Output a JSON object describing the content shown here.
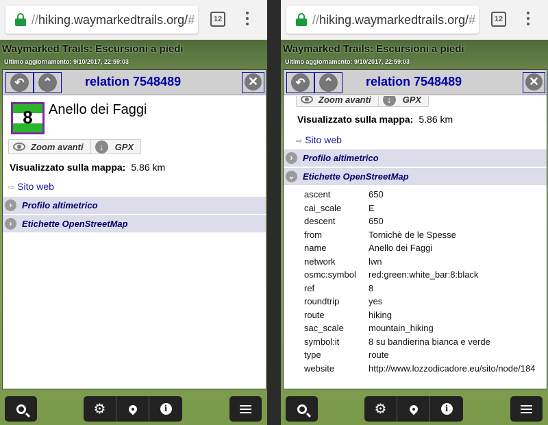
{
  "browser": {
    "url_prefix": "//",
    "url_host": "hiking.waymarkedtrails.org/",
    "url_rest": "#",
    "tab_count": "12"
  },
  "site": {
    "title": "Waymarked Trails: Escursioni a piedi",
    "last_update": "Ultimo aggiornamento: 9/10/2017, 22:59:03"
  },
  "panel": {
    "title": "relation 7548489",
    "back_icon": "undo-icon",
    "up_icon": "chevron-up-icon",
    "close_icon": "close-icon"
  },
  "route": {
    "symbol_number": "8",
    "name": "Anello dei Faggi",
    "zoom_label": "Zoom avanti",
    "gpx_label": "GPX",
    "distance_label": "Visualizzato sulla mappa:",
    "distance_value": "5.86 km",
    "website_label": "Sito web"
  },
  "sections": {
    "elevation": "Profilo altimetrico",
    "osm_tags": "Etichette OpenStreetMap"
  },
  "tags": [
    {
      "key": "ascent",
      "value": "650"
    },
    {
      "key": "cai_scale",
      "value": "E"
    },
    {
      "key": "descent",
      "value": "650"
    },
    {
      "key": "from",
      "value": "Tornichè de le Spesse"
    },
    {
      "key": "name",
      "value": "Anello dei Faggi"
    },
    {
      "key": "network",
      "value": "lwn"
    },
    {
      "key": "osmc:symbol",
      "value": "red:green:white_bar:8:black"
    },
    {
      "key": "ref",
      "value": "8"
    },
    {
      "key": "roundtrip",
      "value": "yes"
    },
    {
      "key": "route",
      "value": "hiking"
    },
    {
      "key": "sac_scale",
      "value": "mountain_hiking"
    },
    {
      "key": "symbol:it",
      "value": "8 su bandierina bianca e verde"
    },
    {
      "key": "type",
      "value": "route"
    },
    {
      "key": "website",
      "value": "http://www.lozzodicadore.eu/sito/node/184"
    }
  ],
  "toolbar": {
    "search_icon": "search-icon",
    "settings_icon": "gear-icon",
    "location_icon": "map-pin-icon",
    "info_icon": "info-icon",
    "list_icon": "list-icon"
  },
  "colors": {
    "accent_blue": "#0000a8",
    "symbol_green": "#2bb52b",
    "symbol_border": "#7b2ca0",
    "section_bg": "#dcdcea",
    "lock_green": "#1a9a3c"
  }
}
